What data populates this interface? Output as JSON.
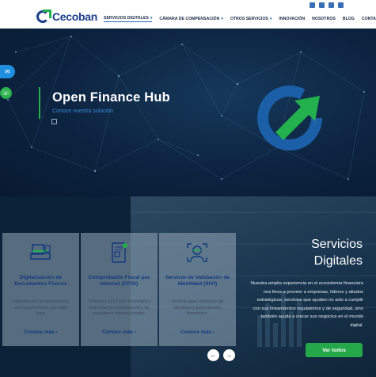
{
  "brand": {
    "logo_text": "Cecoban"
  },
  "nav": {
    "items": [
      {
        "label": "SERVICIOS DIGITALES",
        "dropdown": true,
        "active": true
      },
      {
        "label": "CÁMARA DE COMPENSACIÓN",
        "dropdown": true,
        "active": false
      },
      {
        "label": "OTROS SERVICIOS",
        "dropdown": true,
        "active": false
      },
      {
        "label": "INNOVACIÓN",
        "dropdown": false,
        "active": false
      },
      {
        "label": "NOSOTROS",
        "dropdown": false,
        "active": false
      },
      {
        "label": "BLOG",
        "dropdown": false,
        "active": false
      },
      {
        "label": "CONTACTO",
        "dropdown": false,
        "active": false
      }
    ],
    "social_icons": [
      "twitter-icon",
      "facebook-icon",
      "youtube-icon",
      "linkedin-icon"
    ]
  },
  "hero": {
    "title": "Open Finance Hub",
    "subtitle": "Conoce nuestra solución"
  },
  "services": {
    "heading_line1": "Servicios",
    "heading_line2": "Digitales",
    "description": "Nuestra amplia experiencia en el ecosistema financiero nos lleva a proveer a empresas, líderes y aliados estratégicos, servicios que ayuden no solo a cumplir con sus lineamientos regulatorios y de seguridad, sino también ayuda a crecer sus negocios en el mundo digital.",
    "cta_label": "Ver todos",
    "cards": [
      {
        "icon": "document-scanner-icon",
        "title": "Digitalización de Documentos Físicos",
        "description": "Digitalización de documentos con soporte físico con valor legal.",
        "link": "Conoce más"
      },
      {
        "icon": "invoice-qr-icon",
        "title": "Comprobante Fiscal por Internet (CFDI)",
        "description": "Timbrado CFDI con tecnología y seguridad en cumplimientos de estándares internacionales.",
        "link": "Conoce más"
      },
      {
        "icon": "face-recognition-icon",
        "title": "Servicio de Validación de Identidad (SIVI)",
        "description": "Servicio para validación de identidad y autenticación biométrica.",
        "link": "Conoce más"
      }
    ]
  },
  "colors": {
    "brand_blue": "#1b3f8b",
    "brand_green": "#22b14c",
    "hero_bg": "#0c2340",
    "card_title": "#103a80"
  }
}
